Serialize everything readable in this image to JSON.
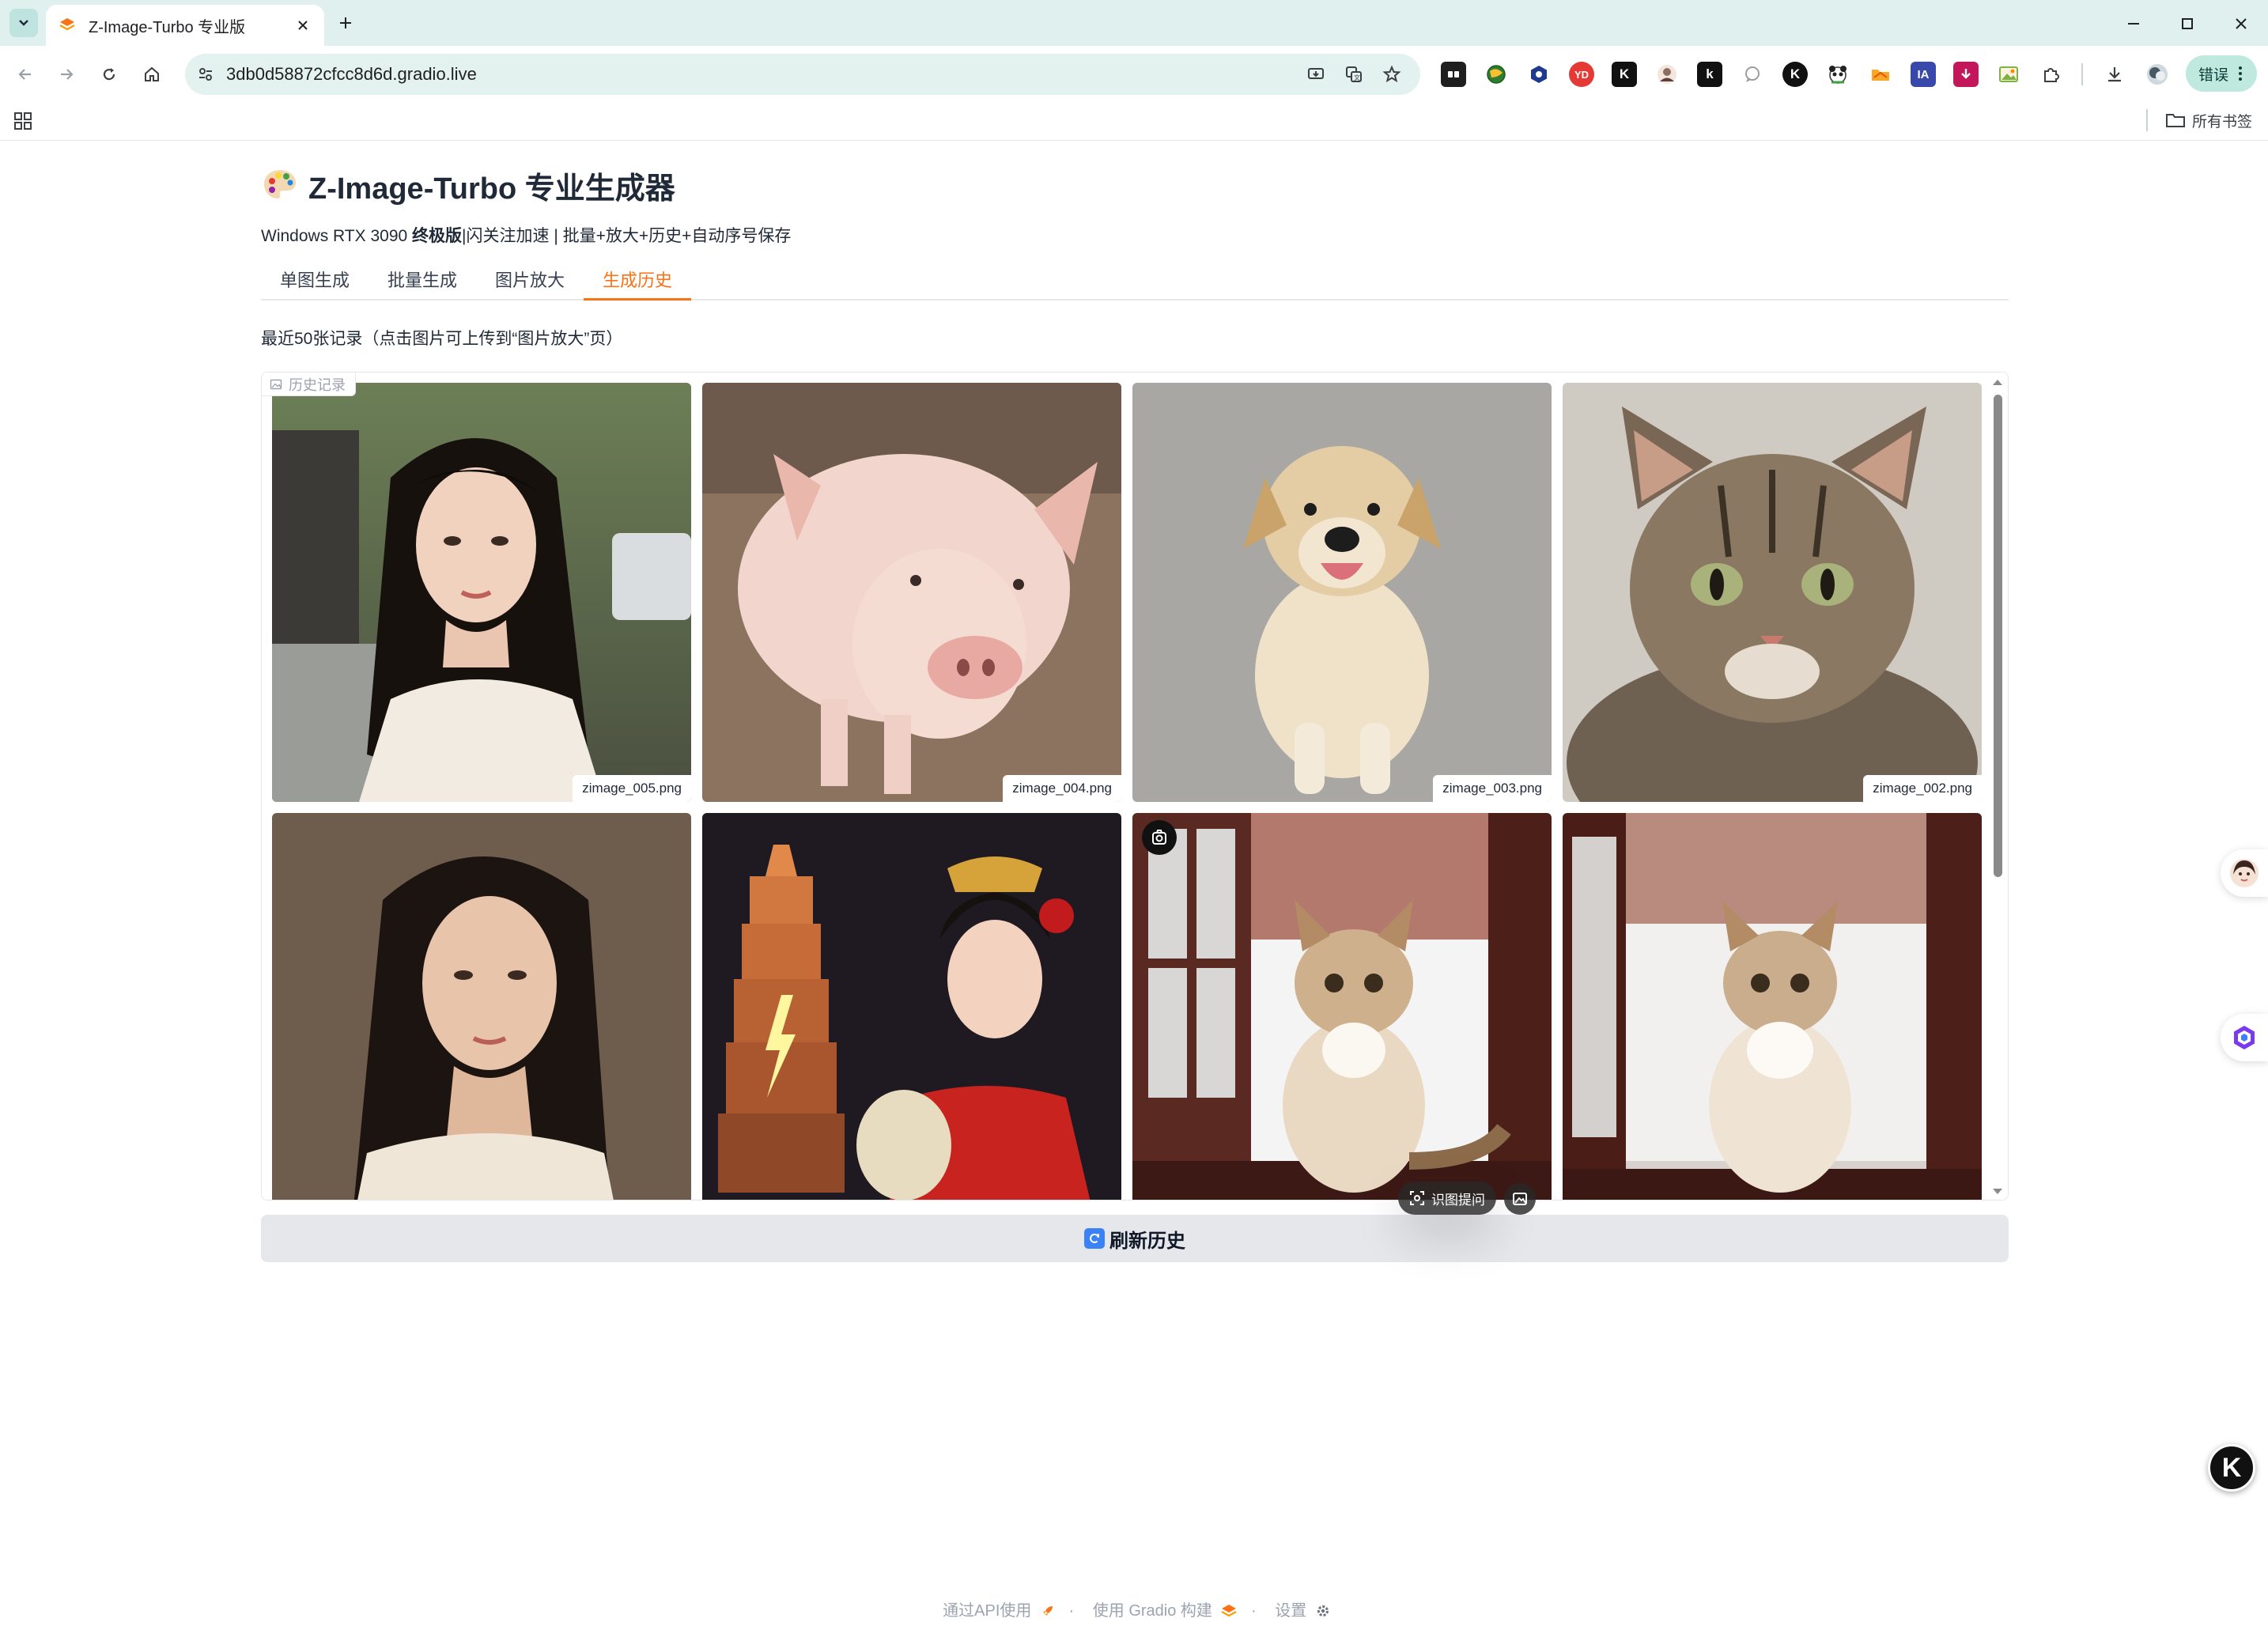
{
  "browser": {
    "tab_title": "Z-Image-Turbo 专业版",
    "url": "3db0d58872cfcc8d6d.gradio.live",
    "profile_status": "错误",
    "bookmarks_all": "所有书签",
    "extensions": [
      {
        "name": "puzzle-ext-icon",
        "glyph": "",
        "color": "#1f1f1f"
      },
      {
        "name": "globe-ext-icon",
        "glyph": "",
        "color": "#2e7d32"
      },
      {
        "name": "hex-ext-icon",
        "glyph": "",
        "color": "#1e3a8a"
      },
      {
        "name": "red-ext-icon",
        "glyph": "",
        "color": "#e53935"
      },
      {
        "name": "k-ext-icon",
        "glyph": "K",
        "color": "#111111"
      },
      {
        "name": "person-ext-icon",
        "glyph": "",
        "color": "#8d6e63"
      },
      {
        "name": "k2-ext-icon",
        "glyph": "k",
        "color": "#111111"
      },
      {
        "name": "chat-ext-icon",
        "glyph": "",
        "color": "#9e9e9e"
      },
      {
        "name": "k3-ext-icon",
        "glyph": "K",
        "color": "#111111"
      },
      {
        "name": "panda-ext-icon",
        "glyph": "",
        "color": "#43a047"
      },
      {
        "name": "folder-ext-icon",
        "glyph": "",
        "color": "#f9a825"
      },
      {
        "name": "ia-ext-icon",
        "glyph": "IA",
        "color": "#3949ab"
      },
      {
        "name": "download-ext-icon",
        "glyph": "",
        "color": "#c2185b"
      },
      {
        "name": "photo-ext-icon",
        "glyph": "",
        "color": "#7cb342"
      }
    ]
  },
  "app": {
    "title": "Z-Image-Turbo 专业生成器",
    "subtitle_prefix": "Windows RTX 3090 ",
    "subtitle_bold": "终极版",
    "subtitle_rest": "|闪关注加速 | 批量+放大+历史+自动序号保存",
    "tabs": [
      {
        "label": "单图生成",
        "active": false
      },
      {
        "label": "批量生成",
        "active": false
      },
      {
        "label": "图片放大",
        "active": false
      },
      {
        "label": "生成历史",
        "active": true
      }
    ],
    "history_note": "最近50张记录（点击图片可上传到“图片放大”页）",
    "gallery_label": "历史记录",
    "images": [
      {
        "subject": "woman-street",
        "caption": "zimage_005.png"
      },
      {
        "subject": "pig",
        "caption": "zimage_004.png"
      },
      {
        "subject": "dog",
        "caption": "zimage_003.png"
      },
      {
        "subject": "tabby-cat",
        "caption": "zimage_002.png"
      },
      {
        "subject": "woman-portrait",
        "caption": ""
      },
      {
        "subject": "hanfu-woman-pagoda",
        "caption": ""
      },
      {
        "subject": "kitten-window",
        "caption": ""
      },
      {
        "subject": "kitten-window-2",
        "caption": ""
      }
    ],
    "image_tool_label": "识图提问",
    "refresh_label": "刷新历史"
  },
  "footer": {
    "api": "通过API使用",
    "built": "使用 Gradio 构建",
    "settings": "设置",
    "sep": "·"
  },
  "colors": {
    "accent": "#f97316",
    "chrome": "#dff0ee"
  }
}
